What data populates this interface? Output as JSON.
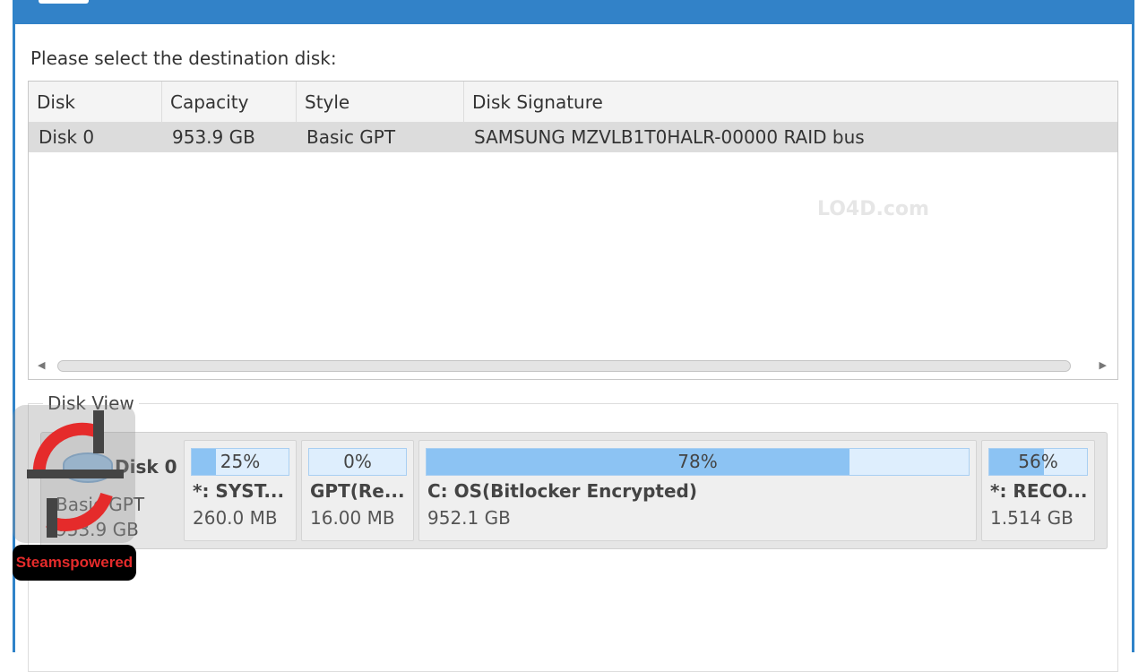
{
  "prompt": "Please select the destination disk:",
  "table": {
    "columns": [
      "Disk",
      "Capacity",
      "Style",
      "Disk Signature"
    ],
    "rows": [
      [
        "Disk 0",
        "953.9 GB",
        "Basic GPT",
        "SAMSUNG MZVLB1T0HALR-00000 RAID bus"
      ]
    ]
  },
  "disk_view": {
    "legend": "Disk View",
    "disk": {
      "name": "Disk 0",
      "style": "Basic GPT",
      "size": "953.9 GB"
    },
    "partitions": [
      {
        "pct": "25%",
        "used": 25,
        "name": "*: SYST...",
        "size": "260.0 MB"
      },
      {
        "pct": "0%",
        "used": 0,
        "name": "GPT(Re...",
        "size": "16.00 MB"
      },
      {
        "pct": "78%",
        "used": 78,
        "name": "C: OS(Bitlocker Encrypted)",
        "size": "952.1 GB"
      },
      {
        "pct": "56%",
        "used": 56,
        "name": "*: RECO...",
        "size": "1.514 GB"
      }
    ]
  },
  "watermark": "LO4D.com",
  "logo_text": "Steamspowered",
  "colors": {
    "titlebar": "#3282c8",
    "bar_fill": "#8cc3f3",
    "bar_bg": "#deeefd",
    "logo_red": "#e52b2b"
  }
}
